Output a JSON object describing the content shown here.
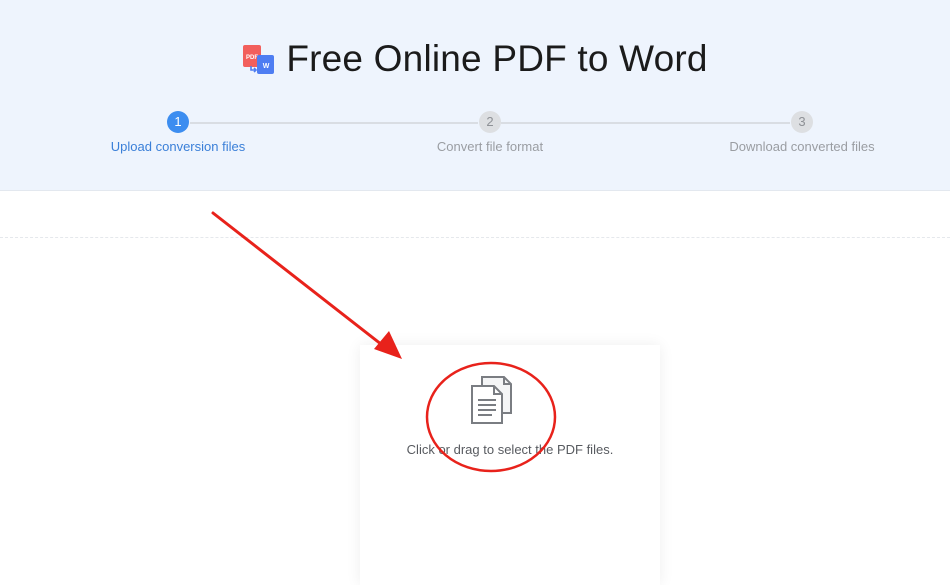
{
  "header": {
    "title": "Free Online PDF to Word",
    "logo_badge_pdf": "PDF",
    "logo_badge_word": "W"
  },
  "steps": [
    {
      "number": "1",
      "label": "Upload conversion files",
      "state": "active"
    },
    {
      "number": "2",
      "label": "Convert file format",
      "state": "inactive"
    },
    {
      "number": "3",
      "label": "Download converted files",
      "state": "inactive"
    }
  ],
  "upload": {
    "prompt": "Click or drag to select the PDF files.",
    "icon": "document-icon"
  },
  "colors": {
    "header_bg": "#eef4fd",
    "accent": "#3c8df0",
    "annotation_red": "#e8221b"
  }
}
